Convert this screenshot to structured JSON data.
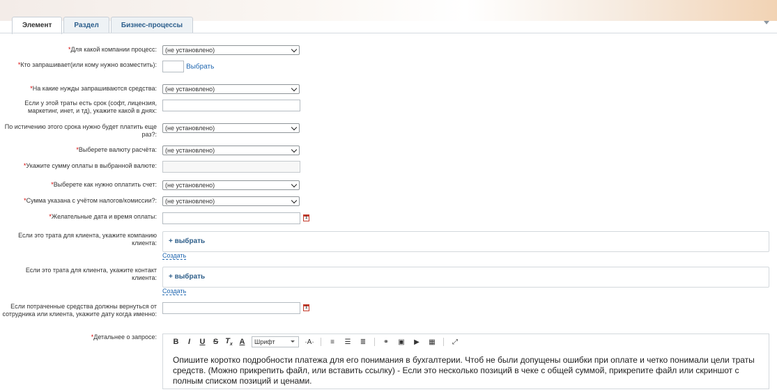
{
  "tabs": [
    "Элемент",
    "Раздел",
    "Бизнес-процессы"
  ],
  "fields": {
    "company": {
      "label": "Для какой компании процесс:",
      "value": "(не установлено)"
    },
    "requester": {
      "label": "Кто запрашивает(или кому нужно возместить):",
      "action": "Выбрать"
    },
    "needs": {
      "label": "На какие нужды запрашиваются средства:",
      "value": "(не установлено)"
    },
    "term": {
      "label": "Если у этой траты есть срок (софт, лицензия, маркетинг, инет, и тд), укажите какой в днях:"
    },
    "repay": {
      "label": "По истичению этого срока нужно будет платить еще раз?:",
      "value": "(не установлено)"
    },
    "currency": {
      "label": "Выберете валюту расчёта:",
      "value": "(не установлено)"
    },
    "amount": {
      "label": "Укажите сумму оплаты в выбранной валюте:"
    },
    "method": {
      "label": "Выберете как нужно оплатить счет:",
      "value": "(не установлено)"
    },
    "taxes": {
      "label": "Сумма указана с учётом налогов/комиссии?:",
      "value": "(не установлено)"
    },
    "date": {
      "label": "Желательные дата и время оплаты:"
    },
    "client_company": {
      "label": "Если это трата для клиента, укажите компанию клиента:",
      "action": "+ выбрать",
      "create": "Создать"
    },
    "client_contact": {
      "label": "Если это трата для клиента, укажите контакт клиента:",
      "action": "+ выбрать",
      "create": "Создать"
    },
    "return_date": {
      "label": "Если потраченные средства должны вернуться от сотрудника или клиента, укажите дату когда именно:"
    },
    "details": {
      "label": "Детальнее о запросе:"
    }
  },
  "editor": {
    "font": "Шрифт",
    "text": "Опишите коротко подробности платежа для его понимания в бухгалтерии. Чтоб не были допущены ошибки при оплате и четко понимали цели траты средств. (Можно прикрепить файл, или вставить ссылку) - Если это несколько позиций в чеке с общей суммой, прикрепите файл или скриншот с полным списком позиций и ценами."
  },
  "colors": {
    "required": "#d30000",
    "link": "#2067b0",
    "tab_text": "#2b5e8c"
  }
}
